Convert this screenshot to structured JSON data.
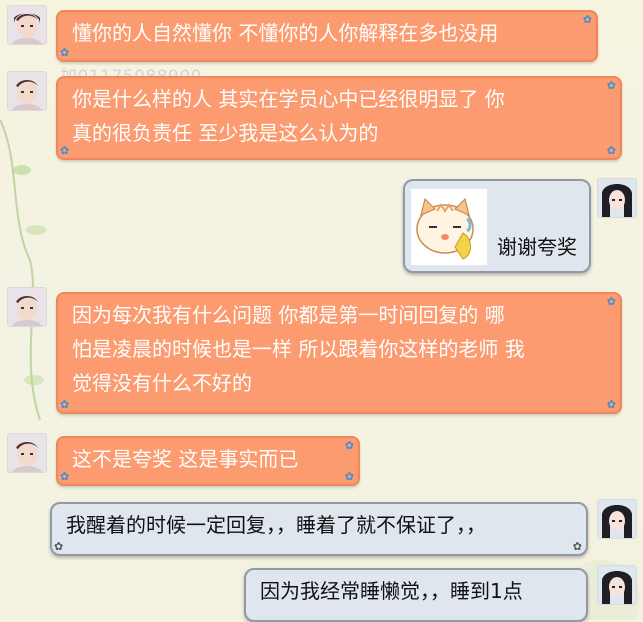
{
  "watermark": "加01175088900",
  "messages": [
    {
      "side": "in",
      "text": "懂你的人自然懂你  不懂你的人你解释在多也没用"
    },
    {
      "side": "in",
      "line1": "你是什么样的人  其实在学员心中已经很明显了    你",
      "line2": "真的很负责任 至少我是这么认为的"
    },
    {
      "side": "out",
      "text": "谢谢夸奖",
      "sticker": "cat-sticker"
    },
    {
      "side": "in",
      "line1": "因为每次我有什么问题  你都是第一时间回复的  哪",
      "line2": "怕是凌晨的时候也是一样 所以跟着你这样的老师  我",
      "line3": "觉得没有什么不好的"
    },
    {
      "side": "in",
      "text": "这不是夸奖  这是事实而已"
    },
    {
      "side": "out",
      "text": "我醒着的时候一定回复，，睡着了就不保证了，，"
    },
    {
      "side": "out",
      "text": "因为我经常睡懒觉，，睡到1点"
    }
  ],
  "colors": {
    "incoming_bubble": "#fb9b6f",
    "outgoing_bubble": "#dfe6ee"
  },
  "icons": {
    "avatar_boy": "boy-avatar-icon",
    "avatar_girl": "girl-avatar-icon",
    "bubble_corner": "flower-corner-icon"
  }
}
